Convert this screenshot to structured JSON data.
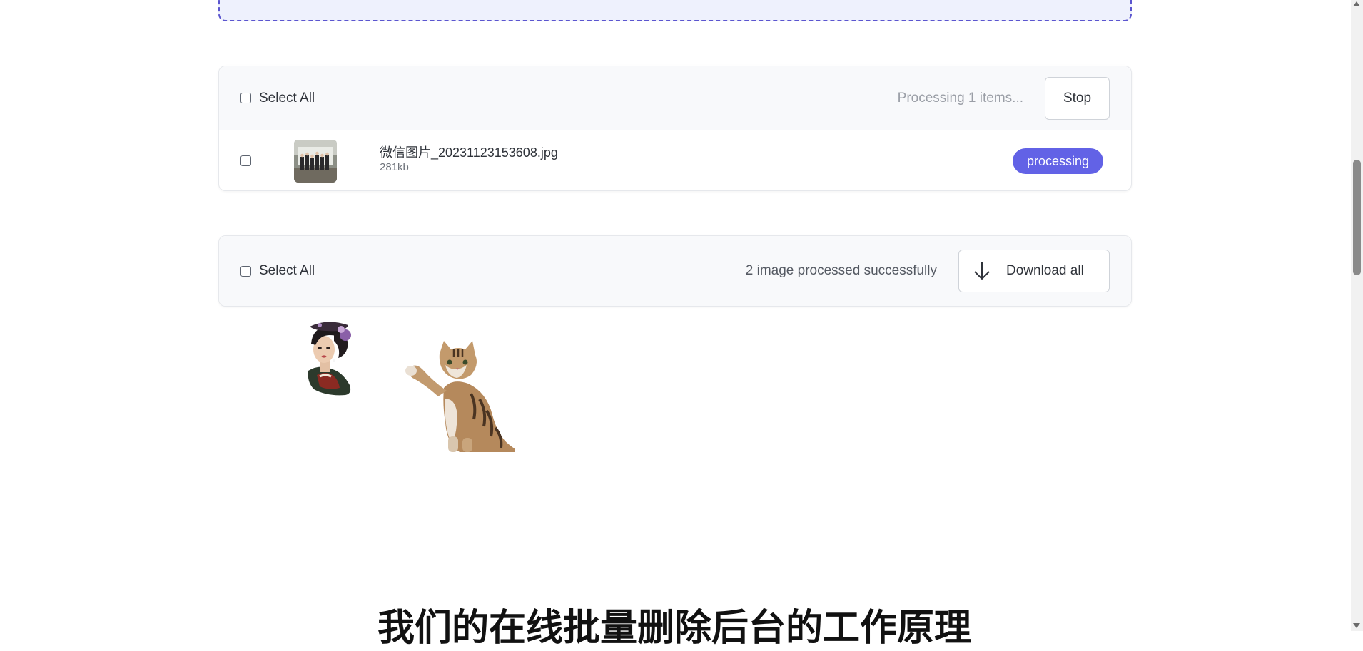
{
  "processing_panel": {
    "select_all_label": "Select All",
    "status": "Processing 1 items...",
    "stop_label": "Stop",
    "files": [
      {
        "name": "微信图片_20231123153608.jpg",
        "size": "281kb",
        "status": "processing"
      }
    ]
  },
  "results_panel": {
    "select_all_label": "Select All",
    "status": "2 image processed successfully",
    "download_label": "Download all",
    "results": [
      "woman-portrait-cutout",
      "cat-cutout"
    ]
  },
  "section_heading": "我们的在线批量删除后台的工作原理",
  "colors": {
    "accent": "#6262e6",
    "dropzone_border": "#5b55cf",
    "dropzone_bg": "#eef1fd",
    "panel_head_bg": "#f8f9fb"
  }
}
